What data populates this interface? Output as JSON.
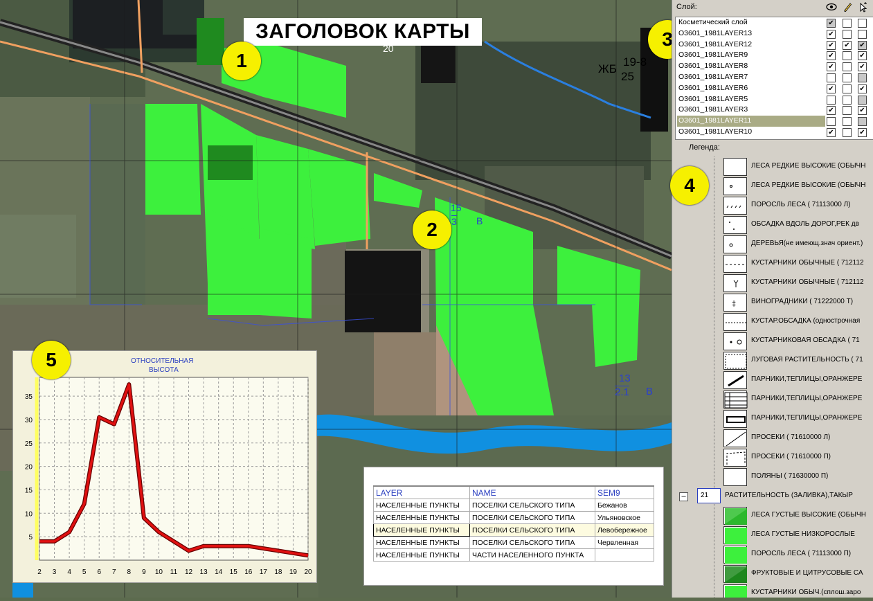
{
  "map": {
    "title": "ЗАГОЛОВОК КАРТЫ",
    "badges": [
      "1",
      "2",
      "3",
      "4",
      "5"
    ],
    "labels": {
      "zhb": "ЖБ",
      "sign1_top": "19-8",
      "sign1_bottom": "25",
      "road_mark": "20",
      "field1_top": "15",
      "field1_mid": "3",
      "field1_letter": "В",
      "field2_top": "13",
      "field2_mid": "2.1",
      "field2_letter": "В"
    },
    "colors": {
      "field": "#3df03d",
      "field_dark": "#1f8a1f",
      "road": "#f0a060",
      "water": "#1090e0"
    }
  },
  "layers": {
    "header_label": "Слой:",
    "icons": [
      "eye-icon",
      "pencil-icon",
      "cursor-select-icon"
    ],
    "items": [
      {
        "name": "Косметический слой",
        "visible": "gray-check",
        "edit": "empty",
        "select": "empty"
      },
      {
        "name": "O3601_1981LAYER13",
        "visible": "check",
        "edit": "empty",
        "select": "empty"
      },
      {
        "name": "O3601_1981LAYER12",
        "visible": "check",
        "edit": "check",
        "select": "gray-check"
      },
      {
        "name": "O3601_1981LAYER9",
        "visible": "check",
        "edit": "empty",
        "select": "check"
      },
      {
        "name": "O3601_1981LAYER8",
        "visible": "check",
        "edit": "empty",
        "select": "check"
      },
      {
        "name": "O3601_1981LAYER7",
        "visible": "empty",
        "edit": "empty",
        "select": "gray"
      },
      {
        "name": "O3601_1981LAYER6",
        "visible": "check",
        "edit": "empty",
        "select": "check"
      },
      {
        "name": "O3601_1981LAYER5",
        "visible": "empty",
        "edit": "empty",
        "select": "gray"
      },
      {
        "name": "O3601_1981LAYER3",
        "visible": "check",
        "edit": "empty",
        "select": "check"
      },
      {
        "name": "O3601_1981LAYER11",
        "visible": "empty",
        "edit": "empty",
        "select": "gray",
        "selected": true
      },
      {
        "name": "O3601_1981LAYER10",
        "visible": "check",
        "edit": "empty",
        "select": "check"
      }
    ]
  },
  "legend": {
    "title": "Легенда:",
    "items": [
      "ЛЕСА РЕДКИЕ ВЫСОКИЕ (ОБЫЧН",
      "ЛЕСА РЕДКИЕ ВЫСОКИЕ (ОБЫЧН",
      "ПОРОСЛЬ ЛЕСА  ( 71113000 Л)",
      "ОБСАДКА ВДОЛЬ ДОРОГ,РЕК дв",
      "ДЕРЕВЬЯ(не имеющ.знач ориент.)",
      "КУСТАРНИКИ ОБЫЧНЫЕ ( 712112",
      "КУСТАРНИКИ ОБЫЧНЫЕ ( 712112",
      "ВИНОГРАДНИКИ  ( 71222000 Т)",
      "КУСТАР.ОБСАДКА (однострочная",
      "КУСТАРНИКОВАЯ ОБСАДКА  ( 71",
      "ЛУГОВАЯ РАСТИТЕЛЬНОСТЬ ( 71",
      "ПАРНИКИ,ТЕПЛИЦЫ,ОРАНЖЕРЕ",
      "ПАРНИКИ,ТЕПЛИЦЫ,ОРАНЖЕРЕ",
      "ПАРНИКИ,ТЕПЛИЦЫ,ОРАНЖЕРЕ",
      "ПРОСЕКИ ( 71610000 Л)",
      "ПРОСЕКИ  ( 71610000 П)",
      "ПОЛЯНЫ ( 71630000 П)"
    ],
    "group": {
      "collapse_symbol": "–",
      "number": "21",
      "label": "РАСТИТЕЛЬНОСТЬ (ЗАЛИВКА),ТАКЫР"
    },
    "group_items": [
      "ЛЕСА ГУСТЫЕ ВЫСОКИЕ (ОБЫЧН",
      "ЛЕСА ГУСТЫЕ НИЗКОРОСЛЫЕ",
      "ПОРОСЛЬ ЛЕСА  ( 71113000 П)",
      "ФРУКТОВЫЕ И ЦИТРУСОВЫЕ СА",
      "КУСТАРНИКИ ОБЫЧ.(сплош.заро"
    ]
  },
  "chart_data": {
    "type": "line",
    "title_line1": "ОТНОСИТЕЛЬНАЯ",
    "title_line2": "ВЫСОТА",
    "x": [
      2,
      3,
      4,
      5,
      6,
      7,
      8,
      9,
      10,
      11,
      12,
      13,
      14,
      15,
      16,
      17,
      18,
      19,
      20
    ],
    "y": [
      4,
      4,
      6,
      12,
      30.5,
      29,
      37.5,
      9,
      6,
      4,
      2,
      3,
      3,
      3,
      3,
      2.5,
      2,
      1.5,
      1
    ],
    "xlim": [
      2,
      20
    ],
    "ylim": [
      0,
      39
    ],
    "yticks": [
      5,
      10,
      15,
      20,
      25,
      30,
      35
    ],
    "grid": true,
    "line_color": "#e01010"
  },
  "table": {
    "headers": [
      "LAYER",
      "NAME",
      "SEM9"
    ],
    "rows": [
      [
        "НАСЕЛЕННЫЕ ПУНКТЫ",
        "ПОСЕЛКИ СЕЛЬСКОГО ТИПА",
        "Бежанов"
      ],
      [
        "НАСЕЛЕННЫЕ ПУНКТЫ",
        "ПОСЕЛКИ СЕЛЬСКОГО ТИПА",
        "Ульяновское"
      ],
      [
        "НАСЕЛЕННЫЕ ПУНКТЫ",
        "ПОСЕЛКИ СЕЛЬСКОГО ТИПА",
        "Левобережное"
      ],
      [
        "НАСЕЛЕННЫЕ ПУНКТЫ",
        "ПОСЕЛКИ СЕЛЬСКОГО ТИПА",
        "Червленная"
      ],
      [
        "НАСЕЛЕННЫЕ ПУНКТЫ",
        "ЧАСТИ НАСЕЛЕННОГО ПУНКТА",
        ""
      ]
    ]
  }
}
